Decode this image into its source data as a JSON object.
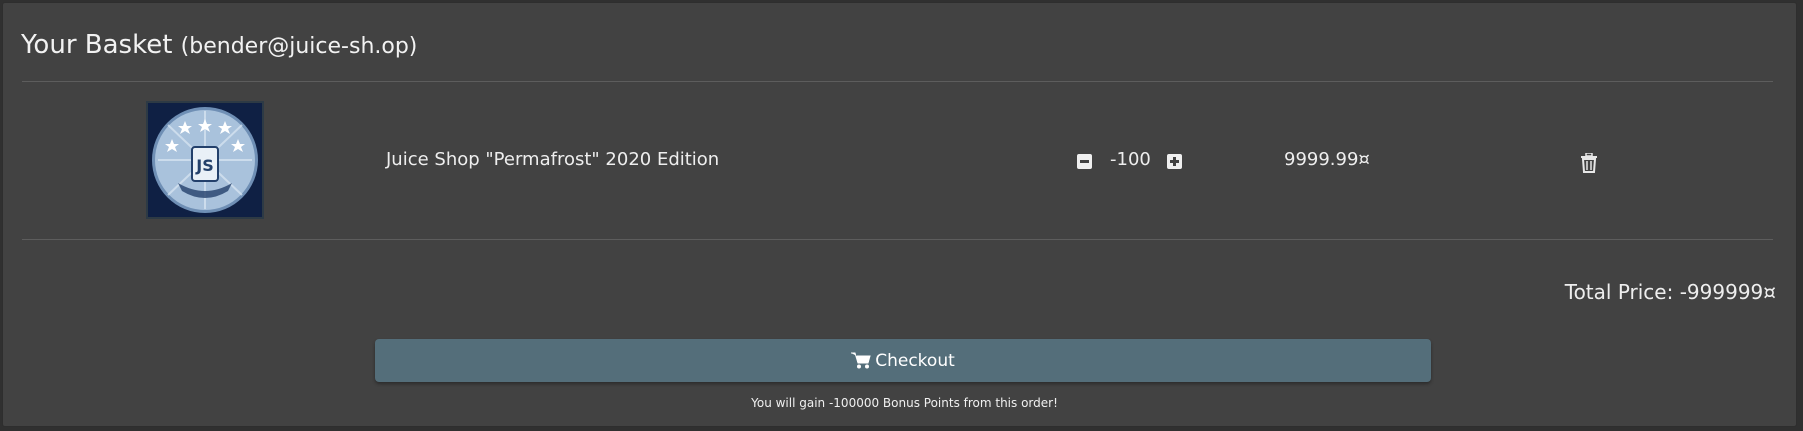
{
  "basket": {
    "title": "Your Basket",
    "user": "(bender@juice-sh.op)"
  },
  "items": [
    {
      "image_icon": "permafrost-logo-icon",
      "name": "Juice Shop \"Permafrost\" 2020 Edition",
      "quantity": "-100",
      "price": "9999.99¤",
      "delete_icon": "trash-icon"
    }
  ],
  "summary": {
    "total_price": "Total Price: -999999¤"
  },
  "checkout": {
    "icon": "cart-icon",
    "label": "Checkout",
    "bonus_text": "You will gain -100000 Bonus Points from this order!"
  },
  "colors": {
    "card_bg": "#424242",
    "page_bg": "#303030",
    "checkout_button": "#546e7a",
    "divider": "#5d5d5d",
    "text": "#ffffff"
  }
}
